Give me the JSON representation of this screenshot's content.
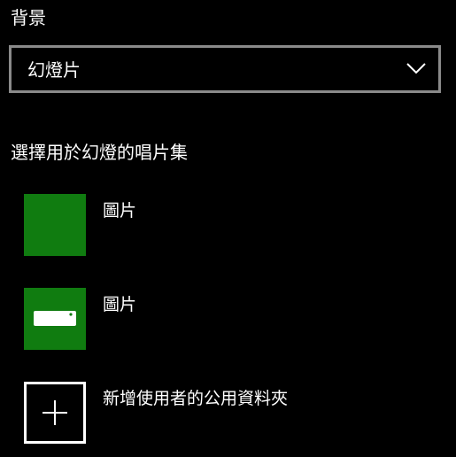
{
  "background": {
    "label": "背景",
    "dropdown": {
      "selected": "幻燈片",
      "icon": "chevron-down-icon"
    }
  },
  "albums": {
    "heading": "選擇用於幻燈的唱片集",
    "items": [
      {
        "label": "圖片",
        "icon": "folder-tile-green",
        "color": "#107c10"
      },
      {
        "label": "圖片",
        "icon": "drive-icon",
        "color": "#107c10"
      },
      {
        "label": "新增使用者的公用資料夾",
        "icon": "plus-icon"
      }
    ]
  },
  "colors": {
    "background": "#000000",
    "accent": "#107c10",
    "border": "#8a8a8a",
    "text": "#ffffff"
  }
}
